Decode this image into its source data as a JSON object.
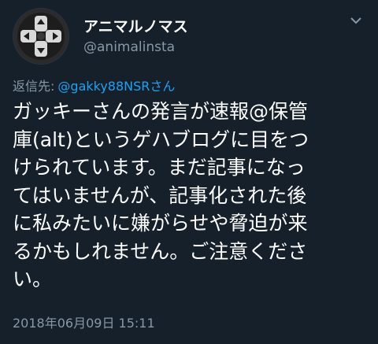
{
  "tweet": {
    "display_name": "アニマルノマス",
    "handle": "@animalinsta",
    "reply_prefix": "返信先:",
    "reply_to": "@gakky88NSRさん",
    "text_lines": [
      "ガッキーさんの発言が速報@保管",
      "庫(alt)というゲハブログに目をつ",
      "けられています。まだ記事になっ",
      "てはいませんが、記事化された後",
      "に私みたいに嫌がらせや脅迫が来",
      "るかもしれません。ご注意くださ",
      "い。"
    ],
    "timestamp": "2018年06月09日 15:11"
  },
  "icons": {
    "avatar": "gamepad-dpad-icon",
    "menu": "chevron-down-icon"
  },
  "colors": {
    "background": "#15202b",
    "primary_text": "#ffffff",
    "secondary_text": "#8899a6",
    "link": "#1da1f2"
  }
}
